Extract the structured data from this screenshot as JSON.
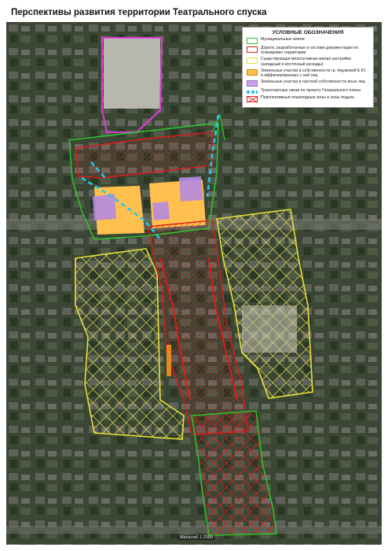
{
  "title": "Перспективы развития территории Театрального спуска",
  "legend": {
    "title": "УСЛОВНЫЕ ОБОЗНАЧЕНИЯ",
    "items": [
      {
        "key": "municipal",
        "label": "Муниципальные земли",
        "color": "#2fc12f"
      },
      {
        "key": "roads",
        "label": "Дороги, разработанные в составе документации по планировке территории",
        "color": "#e01b1b"
      },
      {
        "key": "housing",
        "label": "Существующая многоэтажная жилая застройка (западный и восточный каскады)",
        "color": "#e6e03a"
      },
      {
        "key": "naumova",
        "label": "Земельные участки в собственности гр. Наумовой Е.Ю. и аффилированных с ней лиц",
        "color": "#ffc04d"
      },
      {
        "key": "private",
        "label": "Земельные участки в частной собственности иных лиц",
        "color": "#c9a2e6"
      },
      {
        "key": "transport",
        "label": "Транспортные связи по проекту Генерального плана",
        "color": "#27c8e6"
      },
      {
        "key": "recreation",
        "label": "Перспективные пешеходные зоны и зоны отдыха",
        "color": "#e01b1b"
      }
    ]
  },
  "scale_text": "Масштаб 1:2000"
}
